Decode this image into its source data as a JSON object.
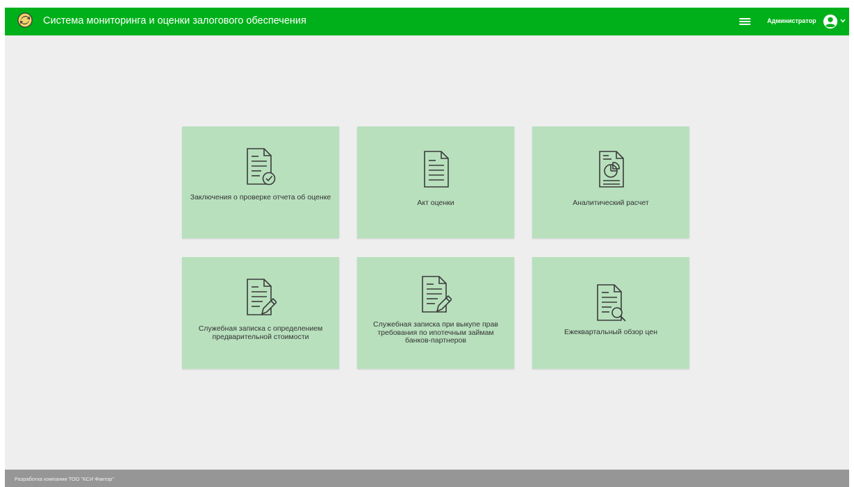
{
  "header": {
    "title": "Система мониторинга и оценки залогового обеспечения",
    "user_name": "Администратор",
    "bar_color": "#00b01a",
    "icons": [
      "logo-icon",
      "menu-icon",
      "user-avatar-icon",
      "chevron-down-icon"
    ]
  },
  "tiles": [
    {
      "label": "Заключения о проверке отчета об оценке",
      "icon": "document-check-icon"
    },
    {
      "label": "Акт оценки",
      "icon": "document-icon"
    },
    {
      "label": "Аналитический расчет",
      "icon": "document-pie-chart-icon"
    },
    {
      "label": "Служебная записка с определением предварительной стоимости",
      "icon": "document-pen-icon"
    },
    {
      "label": "Служебная записка при выкупе прав требования по ипотечным займам банков-партнеров",
      "icon": "document-pen-icon"
    },
    {
      "label": "Ежеквартальный обзор цен",
      "icon": "document-search-icon"
    }
  ],
  "tile_color": "#b8e0bd",
  "footer": {
    "text": "Разработка компании ТОО \"КСИ Фактор\""
  }
}
